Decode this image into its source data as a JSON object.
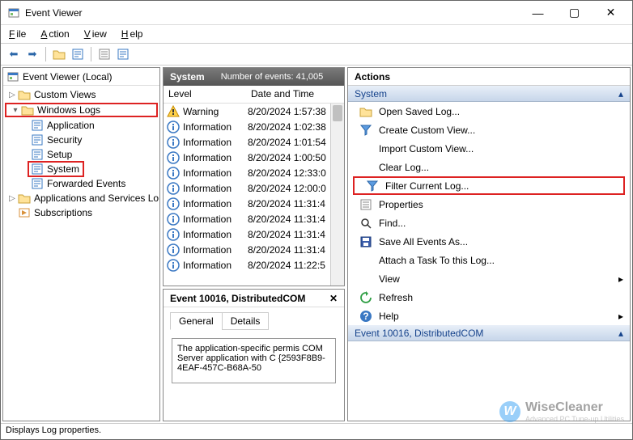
{
  "window": {
    "title": "Event Viewer"
  },
  "menu": {
    "file": "File",
    "action": "Action",
    "view": "View",
    "help": "Help"
  },
  "tree": {
    "root": "Event Viewer (Local)",
    "custom_views": "Custom Views",
    "windows_logs": "Windows Logs",
    "app": "Application",
    "security": "Security",
    "setup": "Setup",
    "system": "System",
    "forwarded": "Forwarded Events",
    "apps_svcs": "Applications and Services Lo",
    "subs": "Subscriptions"
  },
  "center": {
    "title": "System",
    "count_label": "Number of events: 41,005",
    "col_level": "Level",
    "col_dt": "Date and Time",
    "events": [
      {
        "level": "Warning",
        "icon": "warn",
        "dt": "8/20/2024 1:57:38"
      },
      {
        "level": "Information",
        "icon": "info",
        "dt": "8/20/2024 1:02:38"
      },
      {
        "level": "Information",
        "icon": "info",
        "dt": "8/20/2024 1:01:54"
      },
      {
        "level": "Information",
        "icon": "info",
        "dt": "8/20/2024 1:00:50"
      },
      {
        "level": "Information",
        "icon": "info",
        "dt": "8/20/2024 12:33:0"
      },
      {
        "level": "Information",
        "icon": "info",
        "dt": "8/20/2024 12:00:0"
      },
      {
        "level": "Information",
        "icon": "info",
        "dt": "8/20/2024 11:31:4"
      },
      {
        "level": "Information",
        "icon": "info",
        "dt": "8/20/2024 11:31:4"
      },
      {
        "level": "Information",
        "icon": "info",
        "dt": "8/20/2024 11:31:4"
      },
      {
        "level": "Information",
        "icon": "info",
        "dt": "8/20/2024 11:31:4"
      },
      {
        "level": "Information",
        "icon": "info",
        "dt": "8/20/2024 11:22:5"
      }
    ],
    "detail": {
      "title": "Event 10016, DistributedCOM",
      "tab_general": "General",
      "tab_details": "Details",
      "msg": "The application-specific permis COM Server application with C {2593F8B9-4EAF-457C-B68A-50"
    }
  },
  "actions": {
    "title": "Actions",
    "section1": "System",
    "open_saved": "Open Saved Log...",
    "create_cv": "Create Custom View...",
    "import_cv": "Import Custom View...",
    "clear": "Clear Log...",
    "filter": "Filter Current Log...",
    "props": "Properties",
    "find": "Find...",
    "saveas": "Save All Events As...",
    "attach": "Attach a Task To this Log...",
    "view": "View",
    "refresh": "Refresh",
    "help": "Help",
    "section2": "Event 10016, DistributedCOM"
  },
  "status": "Displays Log properties.",
  "watermark": {
    "brand": "WiseCleaner",
    "tag": "Advanced PC Tune-up Utilities"
  }
}
